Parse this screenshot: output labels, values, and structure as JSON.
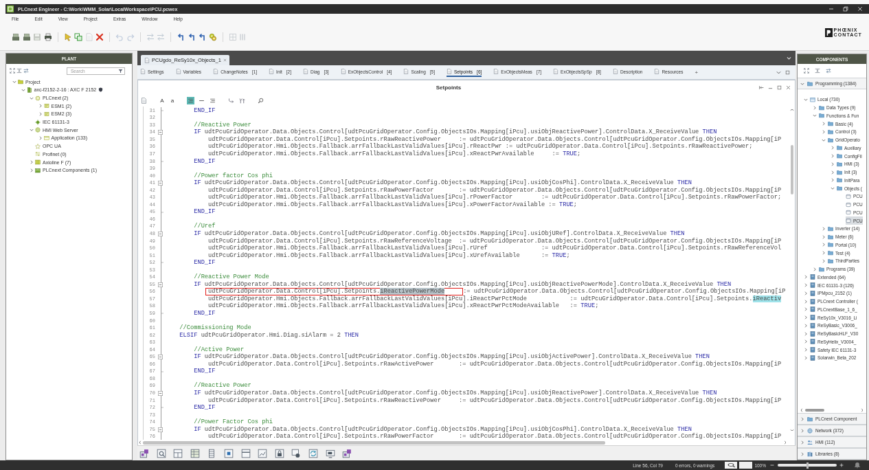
{
  "window": {
    "title": "PLCnext Engineer - C:\\Work\\WMM_Solar\\LocalWorkspace\\PCU.pcwex"
  },
  "menu": [
    "File",
    "Edit",
    "View",
    "Project",
    "Extras",
    "Window",
    "Help"
  ],
  "toolbar": {
    "groups": [
      [
        {
          "kind": "stack",
          "disabled": false
        },
        {
          "kind": "stack",
          "disabled": false
        },
        {
          "kind": "floppy",
          "disabled": true
        },
        {
          "kind": "printer",
          "disabled": false
        }
      ],
      [
        {
          "kind": "pointer",
          "disabled": false
        },
        {
          "kind": "copy",
          "disabled": false
        },
        {
          "kind": "page",
          "disabled": true
        },
        {
          "kind": "cross",
          "disabled": false
        }
      ],
      [
        {
          "kind": "undo",
          "disabled": true
        },
        {
          "kind": "redo",
          "disabled": true
        }
      ],
      [
        {
          "kind": "swap",
          "disabled": true
        },
        {
          "kind": "swap",
          "disabled": true
        }
      ],
      [
        {
          "kind": "bent",
          "disabled": false
        },
        {
          "kind": "bent",
          "disabled": false
        },
        {
          "kind": "bent",
          "disabled": false
        },
        {
          "kind": "gears",
          "disabled": false
        }
      ],
      [
        {
          "kind": "grid",
          "disabled": true
        },
        {
          "kind": "columns",
          "disabled": true
        }
      ]
    ]
  },
  "brand": {
    "lines": [
      "PHŒNIX",
      "CONTACT"
    ]
  },
  "plant": {
    "title": "PLANT",
    "search": {
      "placeholder": "Search"
    },
    "tree": [
      {
        "label": "Project",
        "kind": "folder",
        "expanded": true,
        "selected": false,
        "protected": false,
        "children": [
          {
            "label": "axc-f2152-2-16 : AXC F 2152",
            "kind": "controller",
            "expanded": true,
            "selected": false,
            "protected": true,
            "children": [
              {
                "label": "PLCnext (2)",
                "kind": "chip",
                "expanded": true,
                "selected": false,
                "protected": false,
                "children": [
                  {
                    "label": "ESM1 (2)",
                    "kind": "module",
                    "expanded": false,
                    "selected": false,
                    "protected": false
                  },
                  {
                    "label": "ESM2 (3)",
                    "kind": "module",
                    "expanded": false,
                    "selected": false,
                    "protected": false
                  }
                ]
              },
              {
                "label": "IEC 61131-3",
                "kind": "target",
                "selected": false,
                "protected": false
              },
              {
                "label": "HMI Web Server",
                "kind": "globe",
                "expanded": true,
                "selected": false,
                "protected": false,
                "children": [
                  {
                    "label": "Application (133)",
                    "kind": "window",
                    "expanded": false,
                    "selected": false,
                    "protected": false
                  }
                ]
              },
              {
                "label": "OPC UA",
                "kind": "star",
                "selected": false,
                "protected": false
              },
              {
                "label": "Profinet (0)",
                "kind": "network",
                "selected": false,
                "protected": false
              },
              {
                "label": "Axioline F (7)",
                "kind": "rack",
                "expanded": false,
                "selected": false,
                "protected": false
              },
              {
                "label": "PLCnext Components (1)",
                "kind": "package",
                "expanded": false,
                "selected": false,
                "protected": false
              }
            ]
          }
        ]
      }
    ]
  },
  "editor": {
    "document_tab": {
      "label": "PCUgdo_ReSy10x_Objects_1",
      "selected": true
    },
    "tabs": [
      {
        "label": "Settings",
        "selected": false
      },
      {
        "label": "Variables",
        "selected": false
      },
      {
        "label": "ChangeNotes",
        "number": "[1]",
        "selected": false
      },
      {
        "label": "Init",
        "number": "[2]",
        "selected": false
      },
      {
        "label": "Diag",
        "number": "[3]",
        "selected": false
      },
      {
        "label": "ExObjectsControl",
        "number": "[4]",
        "selected": false
      },
      {
        "label": "Scaling",
        "number": "[5]",
        "selected": false
      },
      {
        "label": "Setpoints",
        "number": "[6]",
        "selected": true
      },
      {
        "label": "ExObjectsMeas",
        "number": "[7]",
        "selected": false
      },
      {
        "label": "ExObjectsSpSp",
        "number": "[8]",
        "selected": false
      },
      {
        "label": "Description",
        "selected": false
      },
      {
        "label": "Resources",
        "selected": false
      }
    ],
    "add_tab": "+",
    "title": "Setpoints",
    "tools": [
      [
        {
          "kind": "page",
          "on": false
        }
      ],
      [
        {
          "kind": "letter",
          "label": "A",
          "on": false
        },
        {
          "kind": "letter",
          "label": "a",
          "on": false
        }
      ],
      [
        {
          "kind": "lines",
          "on": true
        },
        {
          "kind": "dash",
          "on": false
        },
        {
          "kind": "lines",
          "on": false
        }
      ],
      [
        {
          "kind": "branch",
          "on": false
        },
        {
          "kind": "fork",
          "on": false
        }
      ],
      [
        {
          "kind": "search",
          "on": false
        }
      ]
    ],
    "code": {
      "lines": [
        {
          "number": "31",
          "kind": "closer",
          "segments": [
            {
              "kind": "keyword",
              "text": "        END_IF"
            }
          ]
        },
        {
          "number": "32",
          "kind": "plain"
        },
        {
          "number": "33",
          "kind": "plain",
          "segments": [
            {
              "kind": "comment",
              "text": "        //Reactive Power"
            }
          ]
        },
        {
          "number": "34",
          "kind": "opener",
          "segments": [
            {
              "kind": "keyword",
              "text": "        IF"
            },
            {
              "kind": "plain",
              "text": " udtPcuGridOperator.Data.Objects.Control[udtPcuGridOperator.Config.ObjectsIOs.Mapping[iPcu].usiObjReactivePower].ControlData.X_ReceiveValue "
            },
            {
              "kind": "keyword",
              "text": "THEN"
            }
          ]
        },
        {
          "number": "35",
          "kind": "plain",
          "segments": [
            {
              "kind": "plain",
              "text": "            udtPcuGridOperator.Data.Control[iPcu].Setpoints.rRawReactivePower     := udtPcuGridOperator.Data.Objects.Control[udtPcuGridOperator.Config.ObjectsIOs.Mapping[iP"
            }
          ]
        },
        {
          "number": "36",
          "kind": "plain",
          "segments": [
            {
              "kind": "plain",
              "text": "            udtPcuGridOperator.Hmi.Objects.Fallback.arrFallbackLastValidValues[iPcu].rReactPwr := udtPcuGridOperator.Data.Control[iPcu].Setpoints.rRawReactivePower;"
            }
          ]
        },
        {
          "number": "37",
          "kind": "plain",
          "segments": [
            {
              "kind": "plain",
              "text": "            udtPcuGridOperator.Hmi.Objects.Fallback.arrFallbackLastValidValues[iPcu].xReactPwrAvailable     := "
            },
            {
              "kind": "keyword",
              "text": "TRUE"
            },
            {
              "kind": "plain",
              "text": ";"
            }
          ]
        },
        {
          "number": "38",
          "kind": "closer",
          "segments": [
            {
              "kind": "keyword",
              "text": "        END_IF"
            }
          ]
        },
        {
          "number": "39",
          "kind": "plain"
        },
        {
          "number": "40",
          "kind": "plain",
          "segments": [
            {
              "kind": "comment",
              "text": "        //Power factor Cos phi"
            }
          ]
        },
        {
          "number": "41",
          "kind": "opener",
          "segments": [
            {
              "kind": "keyword",
              "text": "        IF"
            },
            {
              "kind": "plain",
              "text": " udtPcuGridOperator.Data.Objects.Control[udtPcuGridOperator.Config.ObjectsIOs.Mapping[iPcu].usiObjCosPhi].ControlData.X_ReceiveValue "
            },
            {
              "kind": "keyword",
              "text": "THEN"
            }
          ]
        },
        {
          "number": "42",
          "kind": "plain",
          "segments": [
            {
              "kind": "plain",
              "text": "            udtPcuGridOperator.Data.Control[iPcu].Setpoints.rRawPowerFactor       := udtPcuGridOperator.Data.Objects.Control[udtPcuGridOperator.Config.ObjectsIOs.Mapping[iP"
            }
          ]
        },
        {
          "number": "43",
          "kind": "plain",
          "segments": [
            {
              "kind": "plain",
              "text": "            udtPcuGridOperator.Hmi.Objects.Fallback.arrFallbackLastValidValues[iPcu].rPowerFactor        := udtPcuGridOperator.Data.Control[iPcu].Setpoints.rRawPowerFactor;"
            }
          ]
        },
        {
          "number": "44",
          "kind": "plain",
          "segments": [
            {
              "kind": "plain",
              "text": "            udtPcuGridOperator.Hmi.Objects.Fallback.arrFallbackLastValidValues[iPcu].xPowerFactorAvailable := "
            },
            {
              "kind": "keyword",
              "text": "TRUE"
            },
            {
              "kind": "plain",
              "text": ";"
            }
          ]
        },
        {
          "number": "45",
          "kind": "closer",
          "segments": [
            {
              "kind": "keyword",
              "text": "        END_IF"
            }
          ]
        },
        {
          "number": "46",
          "kind": "plain"
        },
        {
          "number": "47",
          "kind": "plain",
          "segments": [
            {
              "kind": "comment",
              "text": "        //Uref"
            }
          ]
        },
        {
          "number": "48",
          "kind": "opener",
          "segments": [
            {
              "kind": "keyword",
              "text": "        IF"
            },
            {
              "kind": "plain",
              "text": " udtPcuGridOperator.Data.Objects.Control[udtPcuGridOperator.Config.ObjectsIOs.Mapping[iPcu].usiObjURef].ControlData.X_ReceiveValue "
            },
            {
              "kind": "keyword",
              "text": "THEN"
            }
          ]
        },
        {
          "number": "49",
          "kind": "plain",
          "segments": [
            {
              "kind": "plain",
              "text": "            udtPcuGridOperator.Data.Control[iPcu].Setpoints.rRawReferenceVoltage  := udtPcuGridOperator.Data.Objects.Control[udtPcuGridOperator.Config.ObjectsIOs.Mapping[iP"
            }
          ]
        },
        {
          "number": "50",
          "kind": "plain",
          "segments": [
            {
              "kind": "plain",
              "text": "            udtPcuGridOperator.Hmi.Objects.Fallback.arrFallbackLastValidValues[iPcu].rUref               := udtPcuGridOperator.Data.Control[iPcu].Setpoints.rRawReferenceVol"
            }
          ]
        },
        {
          "number": "51",
          "kind": "plain",
          "segments": [
            {
              "kind": "plain",
              "text": "            udtPcuGridOperator.Hmi.Objects.Fallback.arrFallbackLastValidValues[iPcu].xUrefAvailable      := "
            },
            {
              "kind": "keyword",
              "text": "TRUE"
            },
            {
              "kind": "plain",
              "text": ";"
            }
          ]
        },
        {
          "number": "52",
          "kind": "closer",
          "segments": [
            {
              "kind": "keyword",
              "text": "        END_IF"
            }
          ]
        },
        {
          "number": "53",
          "kind": "plain"
        },
        {
          "number": "54",
          "kind": "plain",
          "segments": [
            {
              "kind": "comment",
              "text": "        //Reactive Power Mode"
            }
          ]
        },
        {
          "number": "55",
          "kind": "opener",
          "segments": [
            {
              "kind": "keyword",
              "text": "        IF"
            },
            {
              "kind": "plain",
              "text": " udtPcuGridOperator.Data.Objects.Control[udtPcuGridOperator.Config.ObjectsIOs.Mapping[iPcu].usiObjReactivePowerMode].ControlData.X_ReceiveValue "
            },
            {
              "kind": "keyword",
              "text": "THEN"
            }
          ]
        },
        {
          "number": "56",
          "kind": "plain",
          "framed_segments": [
            {
              "kind": "plain",
              "text": "            udtPcuGridOperator.Data.Control[iPcu].Setpoints."
            },
            {
              "kind": "selection",
              "text": "iReactivePowerMode"
            }
          ],
          "segments": [
            {
              "kind": "plain",
              "text": ":= udtPcuGridOperator.Data.Objects.Control[udtPcuGridOperator.Config.ObjectsIOs.Mapping[iP"
            }
          ]
        },
        {
          "number": "57",
          "kind": "plain",
          "segments": [
            {
              "kind": "plain",
              "text": "            udtPcuGridOperator.Hmi.Objects.Fallback.arrFallbackLastValidValues[iPcu].iReactPwrPctMode            := udtPcuGridOperator.Data.Control[iPcu].Setpoints."
            },
            {
              "kind": "match",
              "text": "iReactiv"
            }
          ]
        },
        {
          "number": "58",
          "kind": "plain",
          "segments": [
            {
              "kind": "plain",
              "text": "            udtPcuGridOperator.Hmi.Objects.Fallback.arrFallbackLastValidValues[iPcu].xReactPwrPctModeAvailable   := "
            },
            {
              "kind": "keyword",
              "text": "TRUE"
            },
            {
              "kind": "plain",
              "text": ";"
            }
          ]
        },
        {
          "number": "59",
          "kind": "closer",
          "segments": [
            {
              "kind": "keyword",
              "text": "        END_IF"
            }
          ]
        },
        {
          "number": "60",
          "kind": "plain"
        },
        {
          "number": "61",
          "kind": "plain",
          "segments": [
            {
              "kind": "comment",
              "text": "    //Commissioning Mode"
            }
          ]
        },
        {
          "number": "62",
          "kind": "plain",
          "segments": [
            {
              "kind": "keyword",
              "text": "    ELSIF"
            },
            {
              "kind": "plain",
              "text": " udtPcuGridOperator.Hmi.Diag.siAlarm = 2 "
            },
            {
              "kind": "keyword",
              "text": "THEN"
            }
          ]
        },
        {
          "number": "63",
          "kind": "plain"
        },
        {
          "number": "64",
          "kind": "plain",
          "segments": [
            {
              "kind": "comment",
              "text": "        //Active Power"
            }
          ]
        },
        {
          "number": "65",
          "kind": "opener",
          "segments": [
            {
              "kind": "keyword",
              "text": "        IF"
            },
            {
              "kind": "plain",
              "text": " udtPcuGridOperator.Data.Objects.Control[udtPcuGridOperator.Config.ObjectsIOs.Mapping[iPcu].usiObjActivePower].ControlData.X_ReceiveValue "
            },
            {
              "kind": "keyword",
              "text": "THEN"
            }
          ]
        },
        {
          "number": "66",
          "kind": "plain",
          "segments": [
            {
              "kind": "plain",
              "text": "            udtPcuGridOperator.Data.Control[iPcu].Setpoints.rRawActivePower       := udtPcuGridOperator.Data.Objects.Control[udtPcuGridOperator.Config.ObjectsIOs.Mapping[iP"
            }
          ]
        },
        {
          "number": "67",
          "kind": "closer",
          "segments": [
            {
              "kind": "keyword",
              "text": "        END_IF"
            }
          ]
        },
        {
          "number": "68",
          "kind": "plain"
        },
        {
          "number": "69",
          "kind": "plain",
          "segments": [
            {
              "kind": "comment",
              "text": "        //Reactive Power"
            }
          ]
        },
        {
          "number": "70",
          "kind": "opener",
          "segments": [
            {
              "kind": "keyword",
              "text": "        IF"
            },
            {
              "kind": "plain",
              "text": " udtPcuGridOperator.Data.Objects.Control[udtPcuGridOperator.Config.ObjectsIOs.Mapping[iPcu].usiObjReactivePower].ControlData.X_ReceiveValue "
            },
            {
              "kind": "keyword",
              "text": "THEN"
            }
          ]
        },
        {
          "number": "71",
          "kind": "plain",
          "segments": [
            {
              "kind": "plain",
              "text": "            udtPcuGridOperator.Data.Control[iPcu].Setpoints.rRawReactivePower     := udtPcuGridOperator.Data.Objects.Control[udtPcuGridOperator.Config.ObjectsIOs.Mapping[iP"
            }
          ]
        },
        {
          "number": "72",
          "kind": "closer",
          "segments": [
            {
              "kind": "keyword",
              "text": "        END_IF"
            }
          ]
        },
        {
          "number": "73",
          "kind": "plain"
        },
        {
          "number": "74",
          "kind": "plain",
          "segments": [
            {
              "kind": "comment",
              "text": "        //Power Factor Cos phi"
            }
          ]
        },
        {
          "number": "75",
          "kind": "opener",
          "segments": [
            {
              "kind": "keyword",
              "text": "        IF"
            },
            {
              "kind": "plain",
              "text": " udtPcuGridOperator.Data.Objects.Control[udtPcuGridOperator.Config.ObjectsIOs.Mapping[iPcu].usiObjCosPhi].ControlData.X_ReceiveValue "
            },
            {
              "kind": "keyword",
              "text": "THEN"
            }
          ]
        },
        {
          "number": "76",
          "kind": "plain",
          "segments": [
            {
              "kind": "plain",
              "text": "            udtPcuGridOperator.Data.Control[iPcu].Setpoints.rRawPowerFactor       := udtPcuGridOperator.Data.Objects.Control[udtPcuGridOperator.Config.ObjectsIOs.Mapping[iP"
            }
          ]
        }
      ]
    },
    "bottom_tools": [
      {
        "kind": "plug"
      },
      {
        "kind": "page-search"
      },
      {
        "kind": "split"
      },
      {
        "kind": "table"
      },
      {
        "kind": "tower"
      },
      {
        "kind": "dot-box"
      },
      {
        "kind": "strip"
      },
      {
        "kind": "chart"
      },
      {
        "kind": "lock"
      },
      {
        "kind": "shapes"
      },
      {
        "kind": "cycle"
      },
      {
        "kind": "monitor"
      },
      {
        "kind": "plug"
      }
    ]
  },
  "components": {
    "title": "COMPONENTS",
    "sections": [
      {
        "label": "Programming (1384)",
        "kind": "folder-blue",
        "expanded": true,
        "tree": [
          {
            "label": "Local (730)",
            "kind": "box",
            "expanded": true,
            "selected": false,
            "children": [
              {
                "label": "Data Types (9)",
                "kind": "folder-blue",
                "expanded": false,
                "selected": false
              },
              {
                "label": "Functions & Fun",
                "kind": "folder-blue",
                "expanded": true,
                "selected": false,
                "children": [
                  {
                    "label": "Basic (4)",
                    "kind": "folder-blue",
                    "expanded": false,
                    "selected": false
                  },
                  {
                    "label": "Control (3)",
                    "kind": "folder-blue",
                    "expanded": false,
                    "selected": false
                  },
                  {
                    "label": "GridOperato",
                    "kind": "folder-blue",
                    "expanded": true,
                    "selected": false,
                    "children": [
                      {
                        "label": "Auxiliary",
                        "kind": "folder-blue",
                        "expanded": false,
                        "selected": false
                      },
                      {
                        "label": "ConfigFil",
                        "kind": "folder-blue",
                        "expanded": false,
                        "selected": false
                      },
                      {
                        "label": "HMI (3)",
                        "kind": "folder-blue",
                        "expanded": false,
                        "selected": false
                      },
                      {
                        "label": "Init (3)",
                        "kind": "folder-blue",
                        "expanded": false,
                        "selected": false
                      },
                      {
                        "label": "InitPara",
                        "kind": "folder-blue",
                        "expanded": false,
                        "selected": false
                      },
                      {
                        "label": "Objects (",
                        "kind": "folder-blue",
                        "expanded": true,
                        "selected": false,
                        "children": [
                          {
                            "label": "PCU",
                            "kind": "pou",
                            "selected": false
                          },
                          {
                            "label": "PCU",
                            "kind": "pou",
                            "selected": false
                          },
                          {
                            "label": "PCU",
                            "kind": "pou",
                            "selected": false
                          },
                          {
                            "label": "PCU",
                            "kind": "pou",
                            "selected": true
                          }
                        ]
                      }
                    ]
                  },
                  {
                    "label": "Inverter (14)",
                    "kind": "folder-blue",
                    "expanded": false,
                    "selected": false
                  },
                  {
                    "label": "Meter (6)",
                    "kind": "folder-blue",
                    "expanded": false,
                    "selected": false
                  },
                  {
                    "label": "Portal (10)",
                    "kind": "folder-blue",
                    "expanded": false,
                    "selected": false
                  },
                  {
                    "label": "Test (4)",
                    "kind": "folder-blue",
                    "expanded": false,
                    "selected": false
                  },
                  {
                    "label": "ThirdParties",
                    "kind": "folder-blue",
                    "expanded": false,
                    "selected": false
                  }
                ]
              },
              {
                "label": "Programs (39)",
                "kind": "folder-blue",
                "expanded": false,
                "selected": false
              }
            ]
          },
          {
            "label": "Extended (64)",
            "kind": "library",
            "expanded": false,
            "selected": false
          },
          {
            "label": "IEC 61131-3 (126)",
            "kind": "library",
            "expanded": false,
            "selected": false
          },
          {
            "label": "IPMpcu_2152 (1)",
            "kind": "library",
            "expanded": false,
            "selected": false
          },
          {
            "label": "PLCnext Controller (",
            "kind": "library",
            "expanded": false,
            "selected": false
          },
          {
            "label": "PLCnextBase_1_6_",
            "kind": "library",
            "expanded": false,
            "selected": false
          },
          {
            "label": "ReSy10x_V3016_Li",
            "kind": "library",
            "expanded": false,
            "selected": false
          },
          {
            "label": "ReSyBasic_V3006_",
            "kind": "library",
            "expanded": false,
            "selected": false
          },
          {
            "label": "ReSyBasicHLF_V30",
            "kind": "library",
            "expanded": false,
            "selected": false
          },
          {
            "label": "ReSyHelix_V3004_",
            "kind": "library",
            "expanded": false,
            "selected": false
          },
          {
            "label": "Safety IEC 61131-3",
            "kind": "library",
            "expanded": false,
            "selected": false
          },
          {
            "label": "Solarwin_Beta_202",
            "kind": "library",
            "expanded": false,
            "selected": false
          }
        ]
      },
      {
        "label": "PLCnext Component",
        "kind": "folder-blue",
        "expanded": false
      },
      {
        "label": "Network (372)",
        "kind": "globe-blue",
        "expanded": false
      },
      {
        "label": "HMI (112)",
        "kind": "people",
        "expanded": false
      },
      {
        "label": "Libraries (8)",
        "kind": "books",
        "expanded": false
      }
    ]
  },
  "status_bar": {
    "cursor": "Line 56, Col 79",
    "problems": "0 errors, 0 warnings",
    "zoom": {
      "reading": "100%",
      "level": 0.5
    }
  }
}
